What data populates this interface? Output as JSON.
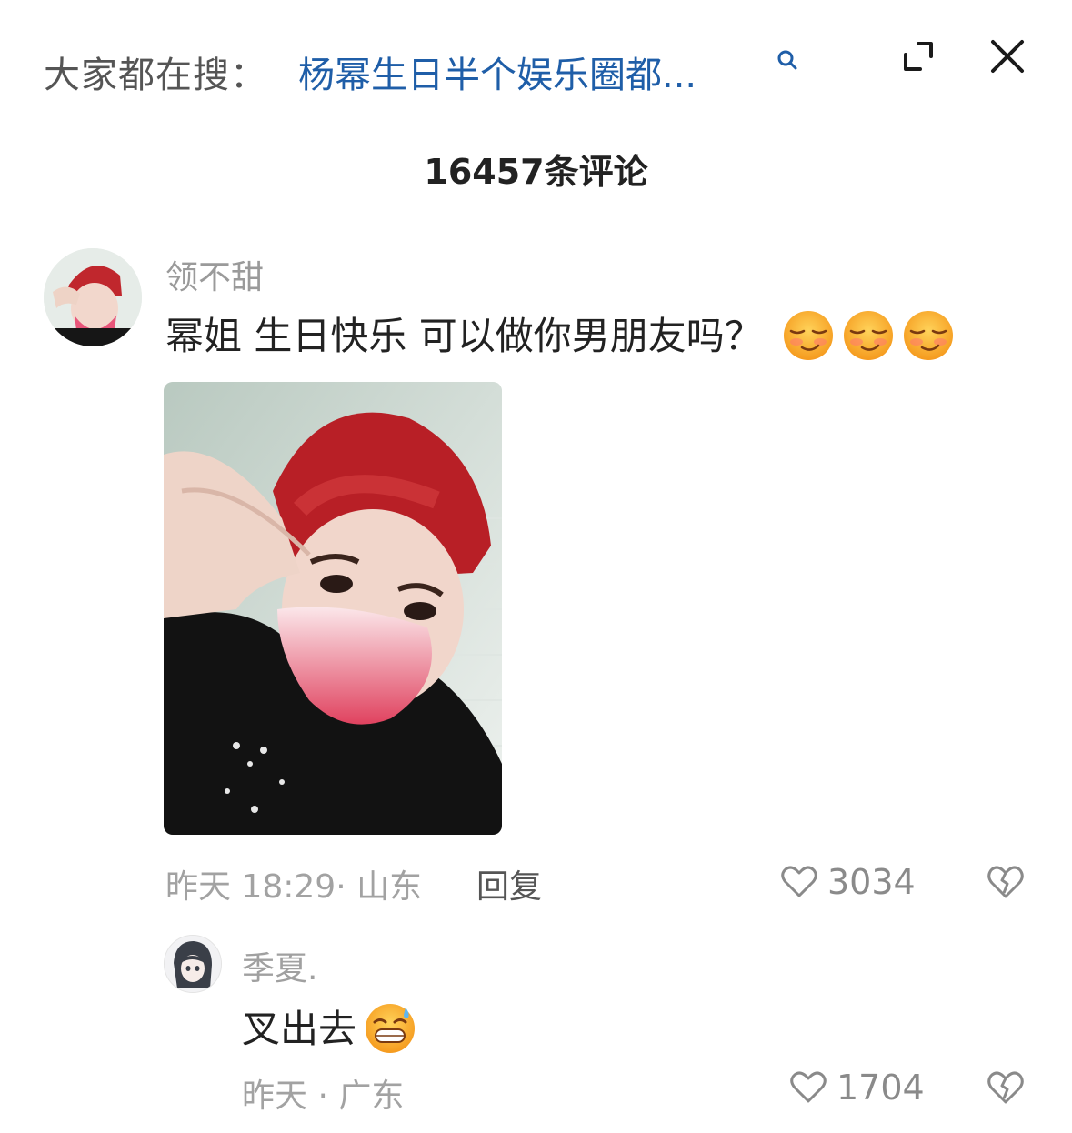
{
  "search": {
    "prefix": "大家都在搜：",
    "query": "杨幂生日半个娱乐圈都...",
    "search_icon": "search-icon",
    "expand_icon": "expand-icon",
    "close_icon": "close-icon"
  },
  "comments_header": {
    "count_label": "16457条评论"
  },
  "comments": [
    {
      "username": "领不甜",
      "text": "幂姐 生日快乐 可以做你男朋友吗？",
      "emojis": [
        "smirk-emoji",
        "smirk-emoji",
        "smirk-emoji"
      ],
      "has_photo": true,
      "time": "昨天 18:29",
      "separator": "·",
      "location": "山东",
      "reply_label": "回复",
      "likes": "3034",
      "like_icon": "heart-outline-icon",
      "dislike_icon": "broken-heart-icon"
    }
  ],
  "replies": [
    {
      "username": "季夏.",
      "text": "叉出去",
      "emoji": "grin-sweat-emoji",
      "time": "昨天",
      "separator": " · ",
      "location": "广东",
      "likes": "1704"
    }
  ],
  "colors": {
    "link": "#1f5ea8",
    "muted": "#a2a2a2",
    "text": "#222222"
  }
}
